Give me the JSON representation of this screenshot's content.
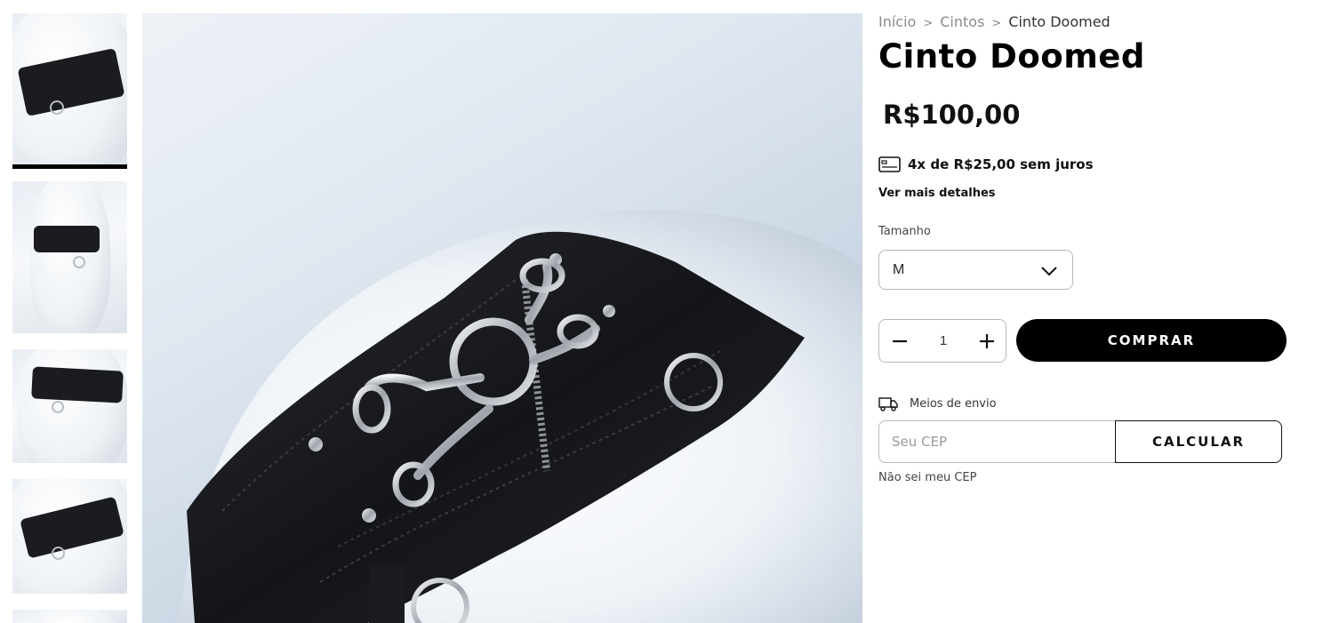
{
  "breadcrumb": {
    "items": [
      "Início",
      "Cintos"
    ],
    "current": "Cinto Doomed",
    "separator": ">"
  },
  "product": {
    "title": "Cinto Doomed",
    "price": "R$100,00",
    "installments": "4x de R$25,00 sem juros",
    "more_details": "Ver mais detalhes"
  },
  "variant": {
    "label": "Tamanho",
    "selected": "M"
  },
  "quantity": {
    "value": "1"
  },
  "buy_button": "COMPRAR",
  "shipping": {
    "label": "Meios de envio",
    "cep_placeholder": "Seu CEP",
    "calculate_button": "CALCULAR",
    "cep_help": "Não sei meu CEP"
  },
  "gallery": {
    "active_index": 0,
    "thumbnail_count": 5
  },
  "colors": {
    "accent": "#000000",
    "muted_text": "#8a8a8a",
    "border": "#b8b8b8",
    "belt": "#1b1c1f",
    "hardware": "#b9bcc2"
  },
  "icons": {
    "card": "credit-card-icon",
    "truck": "truck-icon",
    "chevron": "chevron-down-icon",
    "minus": "minus-icon",
    "plus": "plus-icon"
  }
}
